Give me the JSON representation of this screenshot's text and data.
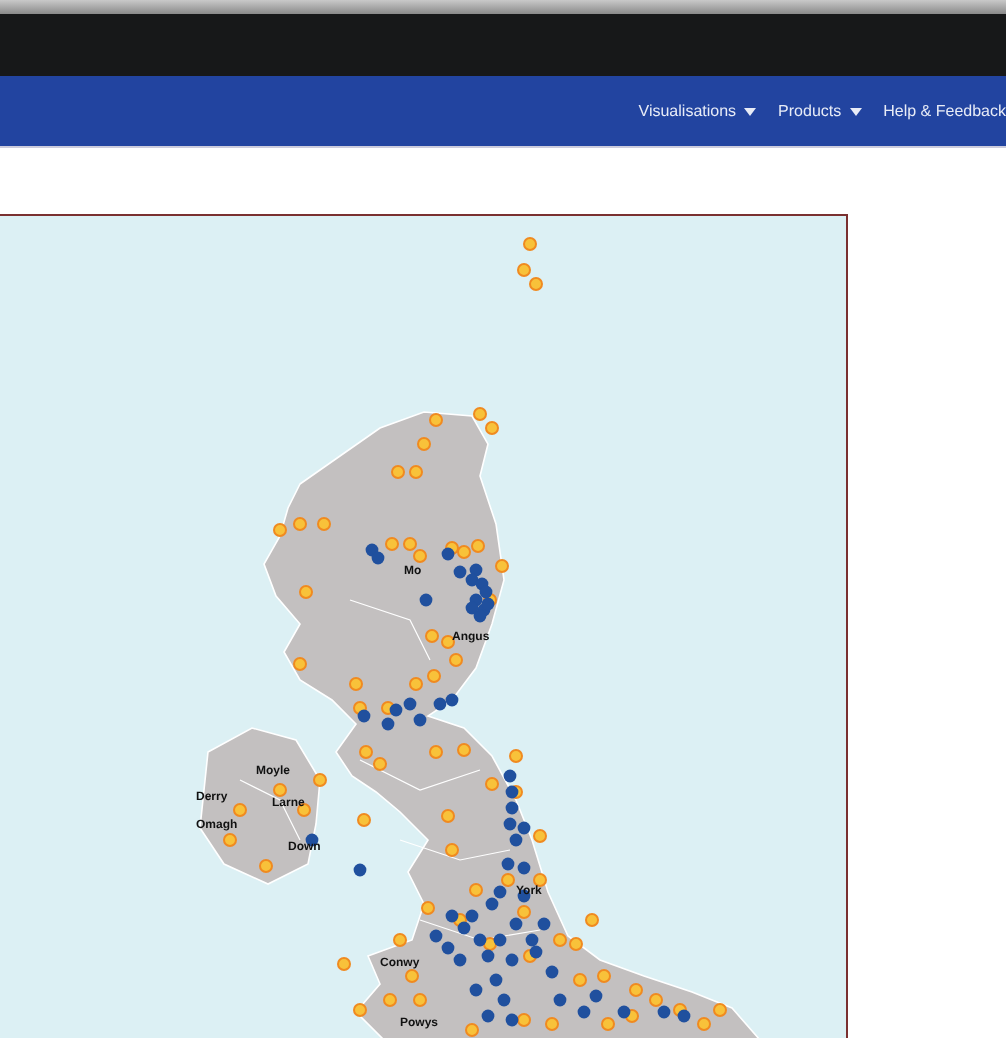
{
  "nav": {
    "items": [
      {
        "label": "Visualisations",
        "dropdown": true
      },
      {
        "label": "Products",
        "dropdown": true
      },
      {
        "label": "Help & Feedback",
        "dropdown": false
      }
    ]
  },
  "map": {
    "region_labels": [
      {
        "text": "Mo"
      },
      {
        "text": "Angus"
      },
      {
        "text": "Moyle"
      },
      {
        "text": "Derry"
      },
      {
        "text": "Larne"
      },
      {
        "text": "Omagh"
      },
      {
        "text": "Down"
      },
      {
        "text": "York"
      },
      {
        "text": "Conwy"
      },
      {
        "text": "Powys"
      }
    ]
  }
}
